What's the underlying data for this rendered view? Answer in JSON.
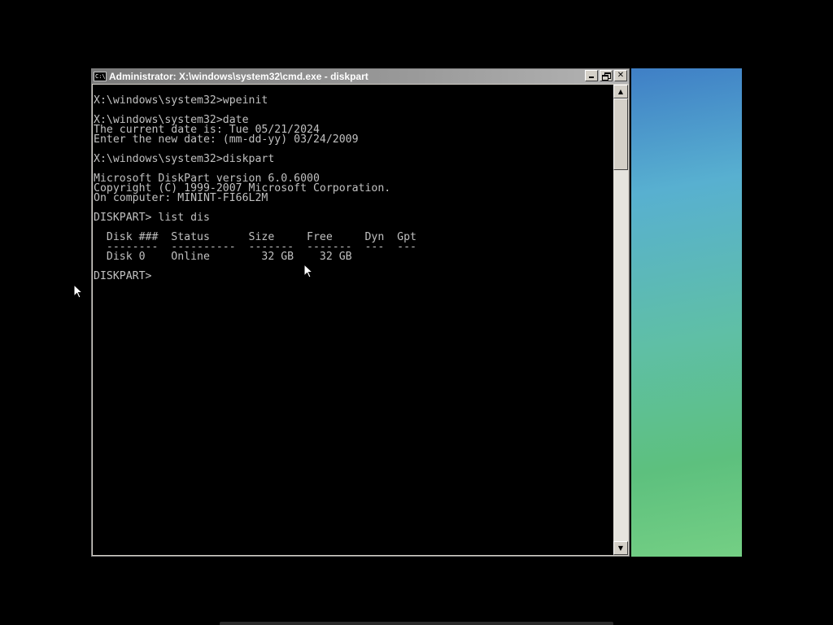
{
  "window": {
    "title": "Administrator: X:\\windows\\system32\\cmd.exe - diskpart",
    "icon_label": "C:\\",
    "buttons": {
      "minimize": "minimize-icon",
      "restore": "restore-icon",
      "close_glyph": "✕"
    }
  },
  "console": {
    "text": "\nX:\\windows\\system32>wpeinit\n\nX:\\windows\\system32>date\nThe current date is: Tue 05/21/2024\nEnter the new date: (mm-dd-yy) 03/24/2009\n\nX:\\windows\\system32>diskpart\n\nMicrosoft DiskPart version 6.0.6000\nCopyright (C) 1999-2007 Microsoft Corporation.\nOn computer: MININT-FI66L2M\n\nDISKPART> list dis\n\n  Disk ###  Status      Size     Free     Dyn  Gpt\n  --------  ----------  -------  -------  ---  ---\n  Disk 0    Online        32 GB    32 GB\n\nDISKPART> "
  },
  "scrollbar": {
    "up_glyph": "▲",
    "down_glyph": "▼"
  },
  "icons": {
    "cursor": "mouse-pointer-icon"
  },
  "colors": {
    "console_bg": "#000000",
    "console_text": "#c0c0c0",
    "titlebar": "#8a8a8a",
    "wallpaper_top": "#3f7fc6",
    "wallpaper_bottom": "#74cf84"
  }
}
